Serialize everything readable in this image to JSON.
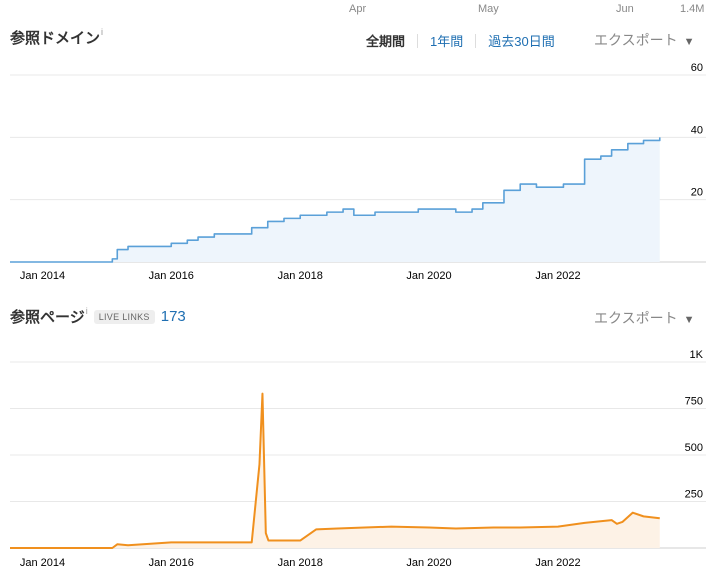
{
  "top_axis": {
    "labels": [
      "Apr",
      "May",
      "Jun",
      "1.4M"
    ]
  },
  "domains_section": {
    "title": "参照ドメイン",
    "info": "i",
    "ranges": [
      "全期間",
      "1年間",
      "過去30日間"
    ],
    "active_range": "全期間",
    "export_label": "エクスポート",
    "caret": "▼"
  },
  "pages_section": {
    "title": "参照ページ",
    "info": "i",
    "badge": "LIVE LINKS",
    "count": "173",
    "export_label": "エクスポート",
    "caret": "▼"
  },
  "colors": {
    "domains_line": "#5aa0d8",
    "domains_fill": "#eef5fc",
    "pages_line": "#f0901e",
    "pages_fill": "#fdf2e6",
    "grid": "#e8e8e8",
    "link": "#1f6fb2"
  },
  "chart_data": [
    {
      "type": "line",
      "step": true,
      "title": "参照ドメイン",
      "x_ticks": [
        "Jan 2014",
        "Jan 2016",
        "Jan 2018",
        "Jan 2020",
        "Jan 2022"
      ],
      "y_ticks": [
        "20",
        "40",
        "60"
      ],
      "ylim": [
        0,
        60
      ],
      "xlim": [
        "2013-07-01",
        "2023-11-01"
      ],
      "grid": true,
      "series": [
        {
          "x": [
            "2013-07-01",
            "2015-02-01",
            "2015-03-01",
            "2015-05-01",
            "2015-08-01",
            "2016-01-01",
            "2016-04-01",
            "2016-06-01",
            "2016-09-01",
            "2017-01-01",
            "2017-04-01",
            "2017-07-01",
            "2017-10-01",
            "2018-01-01",
            "2018-06-01",
            "2018-09-01",
            "2018-11-01",
            "2019-03-01",
            "2019-07-01",
            "2019-11-01",
            "2020-03-01",
            "2020-06-01",
            "2020-09-01",
            "2020-11-01",
            "2021-03-01",
            "2021-06-01",
            "2021-09-01",
            "2021-12-01",
            "2022-02-01",
            "2022-06-01",
            "2022-09-01",
            "2022-11-01",
            "2023-02-01",
            "2023-05-01",
            "2023-08-01"
          ],
          "y": [
            0,
            1,
            4,
            5,
            5,
            6,
            7,
            8,
            9,
            9,
            11,
            13,
            14,
            15,
            16,
            17,
            15,
            16,
            16,
            17,
            17,
            16,
            17,
            19,
            23,
            25,
            24,
            24,
            25,
            33,
            34,
            36,
            38,
            39,
            40
          ]
        }
      ]
    },
    {
      "type": "area",
      "title": "参照ページ",
      "x_ticks": [
        "Jan 2014",
        "Jan 2016",
        "Jan 2018",
        "Jan 2020",
        "Jan 2022"
      ],
      "y_ticks": [
        "250",
        "500",
        "750",
        "1K"
      ],
      "ylim": [
        0,
        1000
      ],
      "xlim": [
        "2013-07-01",
        "2023-11-01"
      ],
      "grid": true,
      "series": [
        {
          "x": [
            "2013-07-01",
            "2015-02-01",
            "2015-03-01",
            "2015-05-01",
            "2016-01-01",
            "2017-04-01",
            "2017-05-15",
            "2017-06-01",
            "2017-06-20",
            "2017-07-05",
            "2017-08-01",
            "2018-01-01",
            "2018-04-01",
            "2018-08-01",
            "2019-01-01",
            "2019-06-01",
            "2020-01-01",
            "2020-06-01",
            "2021-01-01",
            "2021-06-01",
            "2022-01-01",
            "2022-06-01",
            "2022-11-01",
            "2022-12-01",
            "2023-01-01",
            "2023-03-01",
            "2023-05-01",
            "2023-08-01"
          ],
          "y": [
            0,
            0,
            20,
            15,
            30,
            30,
            450,
            830,
            80,
            40,
            40,
            40,
            100,
            105,
            110,
            115,
            110,
            105,
            110,
            110,
            115,
            135,
            150,
            130,
            140,
            190,
            170,
            160
          ]
        }
      ]
    }
  ]
}
